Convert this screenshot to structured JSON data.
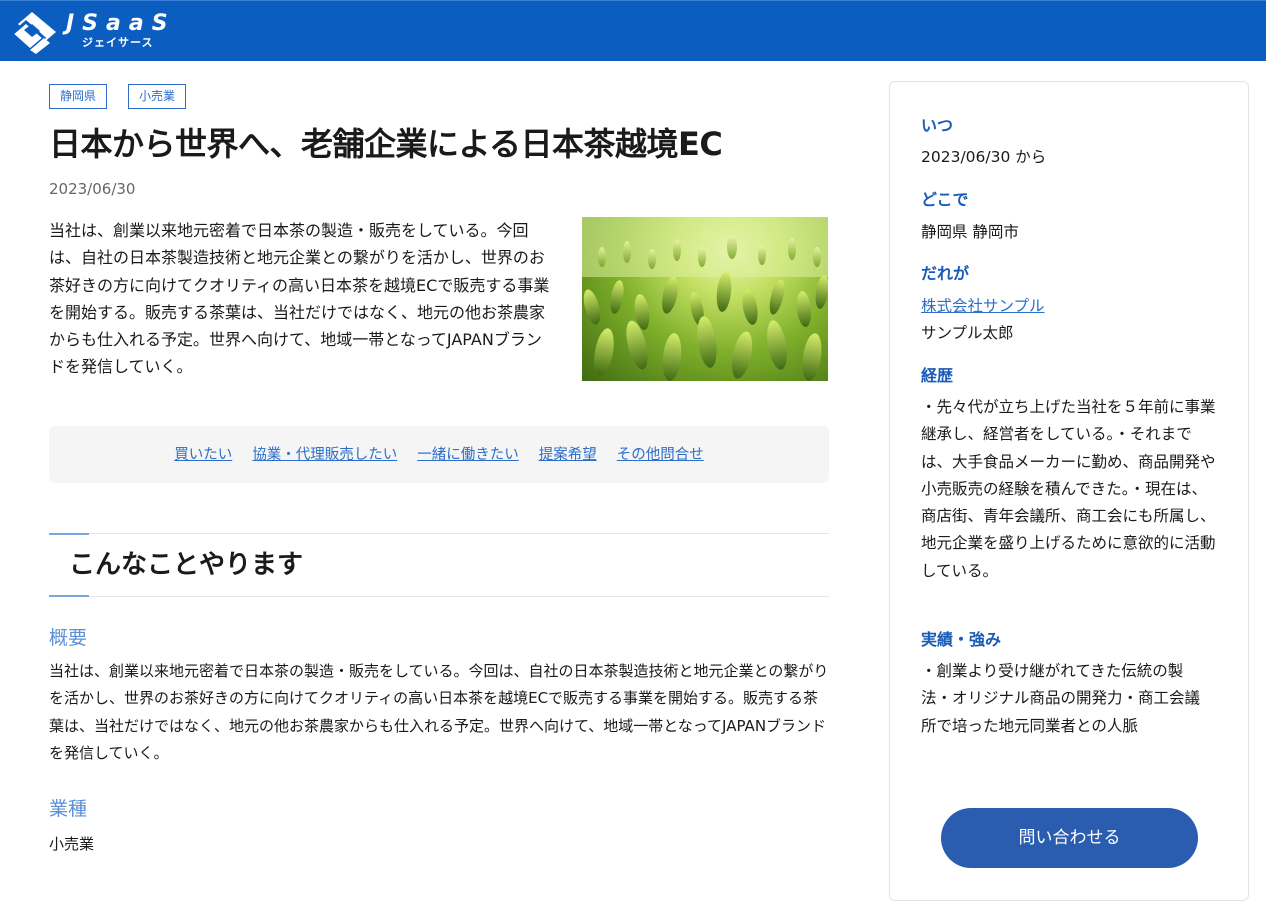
{
  "header": {
    "logo_text": "JSaaS",
    "logo_sub": "ジェイサース",
    "logo_icon": "jsaas-logo-icon",
    "bg_color": "#0b5dc0"
  },
  "post": {
    "tags": [
      "静岡県",
      "小売業"
    ],
    "title": "日本から世界へ、老舗企業による日本茶越境EC",
    "date": "2023/06/30",
    "lead": "当社は、創業以来地元密着で日本茶の製造・販売をしている。今回は、自社の日本茶製造技術と地元企業との繋がりを活かし、世界のお茶好きの方に向けてクオリティの高い日本茶を越境ECで販売する事業を開始する。販売する茶葉は、当社だけではなく、地元の他お茶農家からも仕入れる予定。世界へ向けて、地域一帯となってJAPANブランドを発信していく。",
    "photo": "tea-field-photo",
    "links": [
      "買いたい",
      "協業・代理販売したい",
      "一緒に働きたい",
      "提案希望",
      "その他問合せ"
    ],
    "section_title": "こんなことやります",
    "overview_label": "概要",
    "overview_text": "当社は、創業以来地元密着で日本茶の製造・販売をしている。今回は、自社の日本茶製造技術と地元企業との繋がりを活かし、世界のお茶好きの方に向けてクオリティの高い日本茶を越境ECで販売する事業を開始する。販売する茶葉は、当社だけではなく、地元の他お茶農家からも仕入れる予定。世界へ向けて、地域一帯となってJAPANブランドを発信していく。",
    "industry_label": "業種",
    "industry_value": "小売業"
  },
  "sidebar": {
    "when_label": "いつ",
    "when_value": "2023/06/30  から",
    "where_label": "どこで",
    "where_value": "静岡県 静岡市",
    "who_label": "だれが",
    "company": "株式会社サンプル",
    "person": "サンプル太郎",
    "career_label": "経歴",
    "career_text": "・先々代が立ち上げた当社を５年前に事業継承し、経営者をしている。・それまでは、大手食品メーカーに勤め、商品開発や小売販売の経験を積んできた。・現在は、商店街、青年会議所、商工会にも所属し、地元企業を盛り上げるために意欲的に活動している。",
    "strength_label": "実績・強み",
    "strength_text": "・創業より受け継がれてきた伝統の製法・オリジナル商品の開発力・商工会議所で培った地元同業者との人脈",
    "cta_label": "問い合わせる"
  }
}
